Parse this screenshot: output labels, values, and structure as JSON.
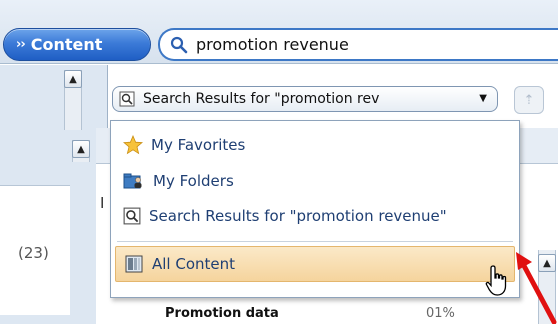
{
  "header": {
    "content_button_label": "Content",
    "search_value": "promotion revenue"
  },
  "left": {
    "count_label": "(23)"
  },
  "combo": {
    "label": "Search Results for \"promotion rev"
  },
  "right": {
    "partial_header": "I",
    "row_label": "Promotion data",
    "row_percent": "01%"
  },
  "menu": {
    "items": [
      {
        "label": "My Favorites",
        "icon": "star-icon"
      },
      {
        "label": "My Folders",
        "icon": "folders-icon"
      },
      {
        "label": "Search Results for \"promotion revenue\"",
        "icon": "search-results-icon"
      },
      {
        "label": "All Content",
        "icon": "all-content-icon",
        "selected": true
      }
    ]
  },
  "colors": {
    "accent": "#2f6fd0",
    "menu_highlight": "#f5d49d",
    "annotation_arrow": "#e01010"
  }
}
